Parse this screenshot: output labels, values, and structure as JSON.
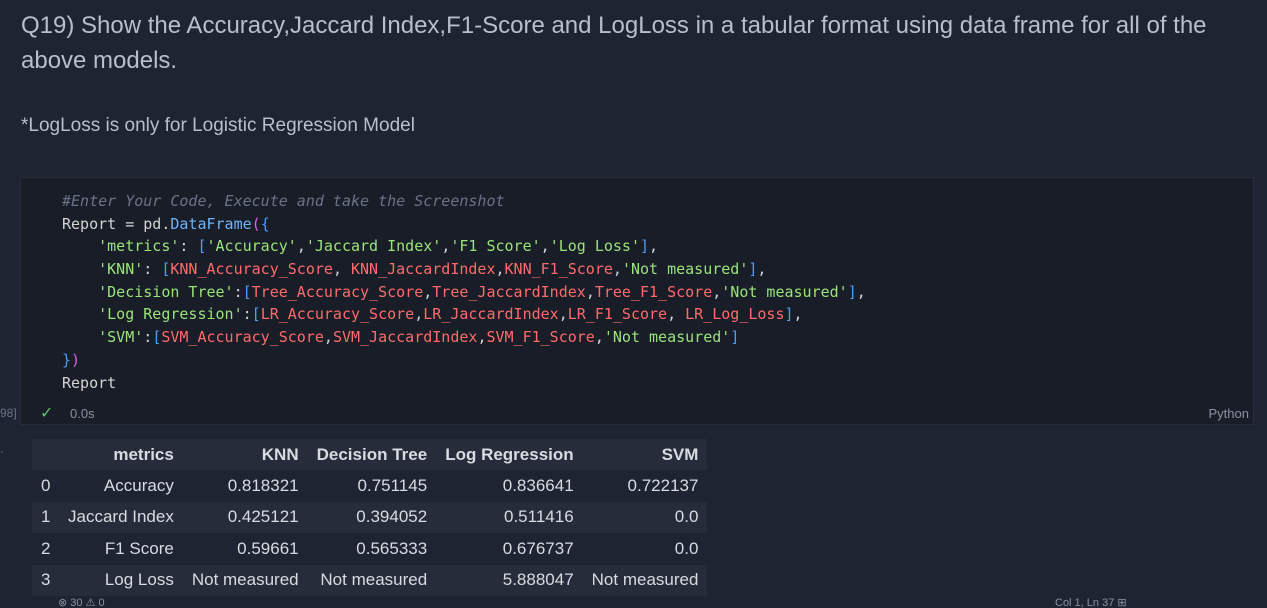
{
  "markdown": {
    "heading": "Q19) Show the Accuracy,Jaccard Index,F1-Score and LogLoss in a tabular format using data frame for all of the above models.",
    "note": "*LogLoss is only for Logistic Regression Model"
  },
  "cell": {
    "code_lines": [
      [
        {
          "t": "#Enter Your Code, Execute and take the Screenshot",
          "c": "c-comment"
        }
      ],
      [
        {
          "t": "Report = pd.",
          "c": "c-plain"
        },
        {
          "t": "DataFrame",
          "c": "c-fn"
        },
        {
          "t": "(",
          "c": "c-paren"
        },
        {
          "t": "{",
          "c": "c-bracket"
        }
      ],
      [
        {
          "t": "    ",
          "c": "c-plain"
        },
        {
          "t": "'metrics'",
          "c": "c-str"
        },
        {
          "t": ": ",
          "c": "c-plain"
        },
        {
          "t": "[",
          "c": "c-bracket"
        },
        {
          "t": "'Accuracy'",
          "c": "c-str"
        },
        {
          "t": ",",
          "c": "c-plain"
        },
        {
          "t": "'Jaccard Index'",
          "c": "c-str"
        },
        {
          "t": ",",
          "c": "c-plain"
        },
        {
          "t": "'F1 Score'",
          "c": "c-str"
        },
        {
          "t": ",",
          "c": "c-plain"
        },
        {
          "t": "'Log Loss'",
          "c": "c-str"
        },
        {
          "t": "]",
          "c": "c-bracket"
        },
        {
          "t": ",",
          "c": "c-plain"
        }
      ],
      [
        {
          "t": "    ",
          "c": "c-plain"
        },
        {
          "t": "'KNN'",
          "c": "c-str"
        },
        {
          "t": ": ",
          "c": "c-plain"
        },
        {
          "t": "[",
          "c": "c-bracket"
        },
        {
          "t": "KNN_Accuracy_Score",
          "c": "c-var"
        },
        {
          "t": ", ",
          "c": "c-plain"
        },
        {
          "t": "KNN_JaccardIndex",
          "c": "c-var"
        },
        {
          "t": ",",
          "c": "c-plain"
        },
        {
          "t": "KNN_F1_Score",
          "c": "c-var"
        },
        {
          "t": ",",
          "c": "c-plain"
        },
        {
          "t": "'Not measured'",
          "c": "c-str"
        },
        {
          "t": "]",
          "c": "c-bracket"
        },
        {
          "t": ",",
          "c": "c-plain"
        }
      ],
      [
        {
          "t": "    ",
          "c": "c-plain"
        },
        {
          "t": "'Decision Tree'",
          "c": "c-str"
        },
        {
          "t": ":",
          "c": "c-plain"
        },
        {
          "t": "[",
          "c": "c-bracket"
        },
        {
          "t": "Tree_Accuracy_Score",
          "c": "c-var"
        },
        {
          "t": ",",
          "c": "c-plain"
        },
        {
          "t": "Tree_JaccardIndex",
          "c": "c-var"
        },
        {
          "t": ",",
          "c": "c-plain"
        },
        {
          "t": "Tree_F1_Score",
          "c": "c-var"
        },
        {
          "t": ",",
          "c": "c-plain"
        },
        {
          "t": "'Not measured'",
          "c": "c-str"
        },
        {
          "t": "]",
          "c": "c-bracket"
        },
        {
          "t": ",",
          "c": "c-plain"
        }
      ],
      [
        {
          "t": "    ",
          "c": "c-plain"
        },
        {
          "t": "'Log Regression'",
          "c": "c-str"
        },
        {
          "t": ":",
          "c": "c-plain"
        },
        {
          "t": "[",
          "c": "c-bracket"
        },
        {
          "t": "LR_Accuracy_Score",
          "c": "c-var"
        },
        {
          "t": ",",
          "c": "c-plain"
        },
        {
          "t": "LR_JaccardIndex",
          "c": "c-var"
        },
        {
          "t": ",",
          "c": "c-plain"
        },
        {
          "t": "LR_F1_Score",
          "c": "c-var"
        },
        {
          "t": ", ",
          "c": "c-plain"
        },
        {
          "t": "LR_Log_Loss",
          "c": "c-var"
        },
        {
          "t": "]",
          "c": "c-bracket"
        },
        {
          "t": ",",
          "c": "c-plain"
        }
      ],
      [
        {
          "t": "    ",
          "c": "c-plain"
        },
        {
          "t": "'SVM'",
          "c": "c-str"
        },
        {
          "t": ":",
          "c": "c-plain"
        },
        {
          "t": "[",
          "c": "c-bracket"
        },
        {
          "t": "SVM_Accuracy_Score",
          "c": "c-var"
        },
        {
          "t": ",",
          "c": "c-plain"
        },
        {
          "t": "SVM_JaccardIndex",
          "c": "c-var"
        },
        {
          "t": ",",
          "c": "c-plain"
        },
        {
          "t": "SVM_F1_Score",
          "c": "c-var"
        },
        {
          "t": ",",
          "c": "c-plain"
        },
        {
          "t": "'Not measured'",
          "c": "c-str"
        },
        {
          "t": "]",
          "c": "c-bracket"
        }
      ],
      [
        {
          "t": "}",
          "c": "c-bracket"
        },
        {
          "t": ")",
          "c": "c-paren"
        }
      ],
      [
        {
          "t": "Report",
          "c": "c-plain"
        }
      ]
    ],
    "exec_count": "98]",
    "exec_time": "0.0s",
    "language": "Python"
  },
  "output_table": {
    "columns": [
      "",
      "metrics",
      "KNN",
      "Decision Tree",
      "Log Regression",
      "SVM"
    ],
    "rows": [
      [
        "0",
        "Accuracy",
        "0.818321",
        "0.751145",
        "0.836641",
        "0.722137"
      ],
      [
        "1",
        "Jaccard Index",
        "0.425121",
        "0.394052",
        "0.511416",
        "0.0"
      ],
      [
        "2",
        "F1 Score",
        "0.59661",
        "0.565333",
        "0.676737",
        "0.0"
      ],
      [
        "3",
        "Log Loss",
        "Not measured",
        "Not measured",
        "5.888047",
        "Not measured"
      ]
    ]
  },
  "status_bar": {
    "errors": "⊗ 30 ⚠ 0",
    "position": "Col 1, Ln 37   ⊞"
  },
  "colors": {
    "background": "#1e2432",
    "cell_background": "#181d28",
    "success": "#55c46a"
  },
  "icons": {
    "check": "check-icon"
  }
}
